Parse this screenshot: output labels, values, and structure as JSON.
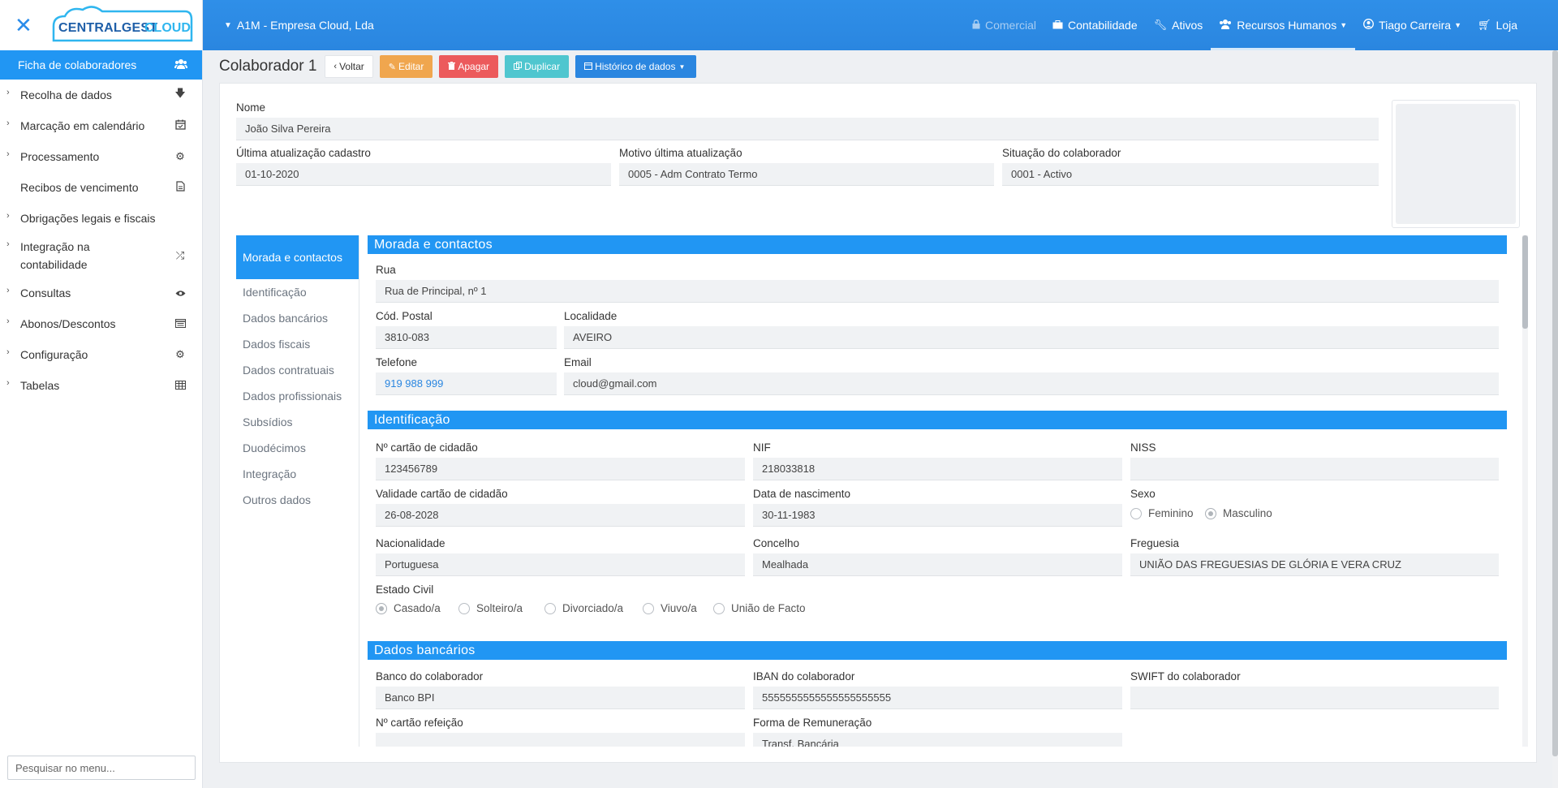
{
  "sidebar": {
    "close_icon": "close-icon",
    "logo": {
      "part1": "CENTRALGEST",
      "part2": "CLOUD"
    },
    "active_item": {
      "label": "Ficha de colaboradores",
      "icon": "users-icon"
    },
    "items": [
      {
        "label": "Recolha de dados",
        "icon": "arrow-down-icon",
        "chevron": true
      },
      {
        "label": "Marcação em calendário",
        "icon": "calendar-check-icon",
        "chevron": true
      },
      {
        "label": "Processamento",
        "icon": "gear-icon",
        "chevron": true
      },
      {
        "label": "Recibos de vencimento",
        "icon": "document-icon",
        "chevron": false
      },
      {
        "label": "Obrigações legais e fiscais",
        "icon": "",
        "chevron": true
      },
      {
        "label": "Integração na contabilidade",
        "icon": "shuffle-icon",
        "chevron": true
      },
      {
        "label": "Consultas",
        "icon": "eye-icon",
        "chevron": true
      },
      {
        "label": "Abonos/Descontos",
        "icon": "list-icon",
        "chevron": true
      },
      {
        "label": "Configuração",
        "icon": "gears-icon",
        "chevron": true
      },
      {
        "label": "Tabelas",
        "icon": "table-icon",
        "chevron": true
      }
    ],
    "search_placeholder": "Pesquisar no menu..."
  },
  "topbar": {
    "company": "A1M - Empresa Cloud, Lda",
    "nav": [
      {
        "label": "Comercial",
        "icon": "lock-icon",
        "disabled": true
      },
      {
        "label": "Contabilidade",
        "icon": "briefcase-icon"
      },
      {
        "label": "Ativos",
        "icon": "wrench-icon"
      },
      {
        "label": "Recursos Humanos",
        "icon": "users-icon",
        "active": true,
        "dropdown": true
      },
      {
        "label": "Tiago Carreira",
        "icon": "user-circle-icon",
        "dropdown": true
      },
      {
        "label": "Loja",
        "icon": "cart-icon"
      }
    ]
  },
  "titlebar": {
    "title": "Colaborador 1",
    "buttons": {
      "voltar": "Voltar",
      "editar": "Editar",
      "apagar": "Apagar",
      "duplicar": "Duplicar",
      "historico": "Histórico de dados"
    }
  },
  "header_fields": {
    "nome": {
      "label": "Nome",
      "value": "João Silva Pereira"
    },
    "ultima_atualizacao": {
      "label": "Última atualização cadastro",
      "value": "01-10-2020"
    },
    "motivo": {
      "label": "Motivo última atualização",
      "value": "0005 - Adm Contrato Termo"
    },
    "situacao": {
      "label": "Situação do colaborador",
      "value": "0001 - Activo"
    }
  },
  "section_nav": [
    "Morada e contactos",
    "Identificação",
    "Dados bancários",
    "Dados fiscais",
    "Dados contratuais",
    "Dados profissionais",
    "Subsídios",
    "Duodécimos",
    "Integração",
    "Outros dados"
  ],
  "morada": {
    "title": "Morada e contactos",
    "rua": {
      "label": "Rua",
      "value": "Rua de Principal, nº 1"
    },
    "cod_postal": {
      "label": "Cód. Postal",
      "value": "3810-083"
    },
    "localidade": {
      "label": "Localidade",
      "value": "AVEIRO"
    },
    "telefone": {
      "label": "Telefone",
      "value": "919 988 999"
    },
    "email": {
      "label": "Email",
      "value": "cloud@gmail.com"
    }
  },
  "identificacao": {
    "title": "Identificação",
    "cartao": {
      "label": "Nº cartão de cidadão",
      "value": "123456789"
    },
    "nif": {
      "label": "NIF",
      "value": "218033818"
    },
    "niss": {
      "label": "NISS",
      "value": ""
    },
    "validade": {
      "label": "Validade cartão de cidadão",
      "value": "26-08-2028"
    },
    "nascimento": {
      "label": "Data de nascimento",
      "value": "30-11-1983"
    },
    "sexo": {
      "label": "Sexo",
      "options": [
        "Feminino",
        "Masculino"
      ],
      "selected": "Masculino"
    },
    "nacionalidade": {
      "label": "Nacionalidade",
      "value": "Portuguesa"
    },
    "concelho": {
      "label": "Concelho",
      "value": "Mealhada"
    },
    "freguesia": {
      "label": "Freguesia",
      "value": "UNIÃO DAS FREGUESIAS DE GLÓRIA E VERA CRUZ"
    },
    "estado_civil": {
      "label": "Estado Civil",
      "options": [
        "Casado/a",
        "Solteiro/a",
        "Divorciado/a",
        "Viuvo/a",
        "União de Facto"
      ],
      "selected": "Casado/a"
    }
  },
  "bancarios": {
    "title": "Dados bancários",
    "banco": {
      "label": "Banco do colaborador",
      "value": "Banco BPI"
    },
    "iban": {
      "label": "IBAN do colaborador",
      "value": "5555555555555555555555"
    },
    "swift": {
      "label": "SWIFT do colaborador",
      "value": ""
    },
    "cartao_refeicao": {
      "label": "Nº cartão refeição",
      "value": ""
    },
    "forma": {
      "label": "Forma de Remuneração",
      "value": "Transf. Bancária"
    }
  },
  "colors": {
    "primary": "#2196f3",
    "editar": "#f0a64e",
    "apagar": "#ec5a5c",
    "duplicar": "#4fc6cf"
  }
}
